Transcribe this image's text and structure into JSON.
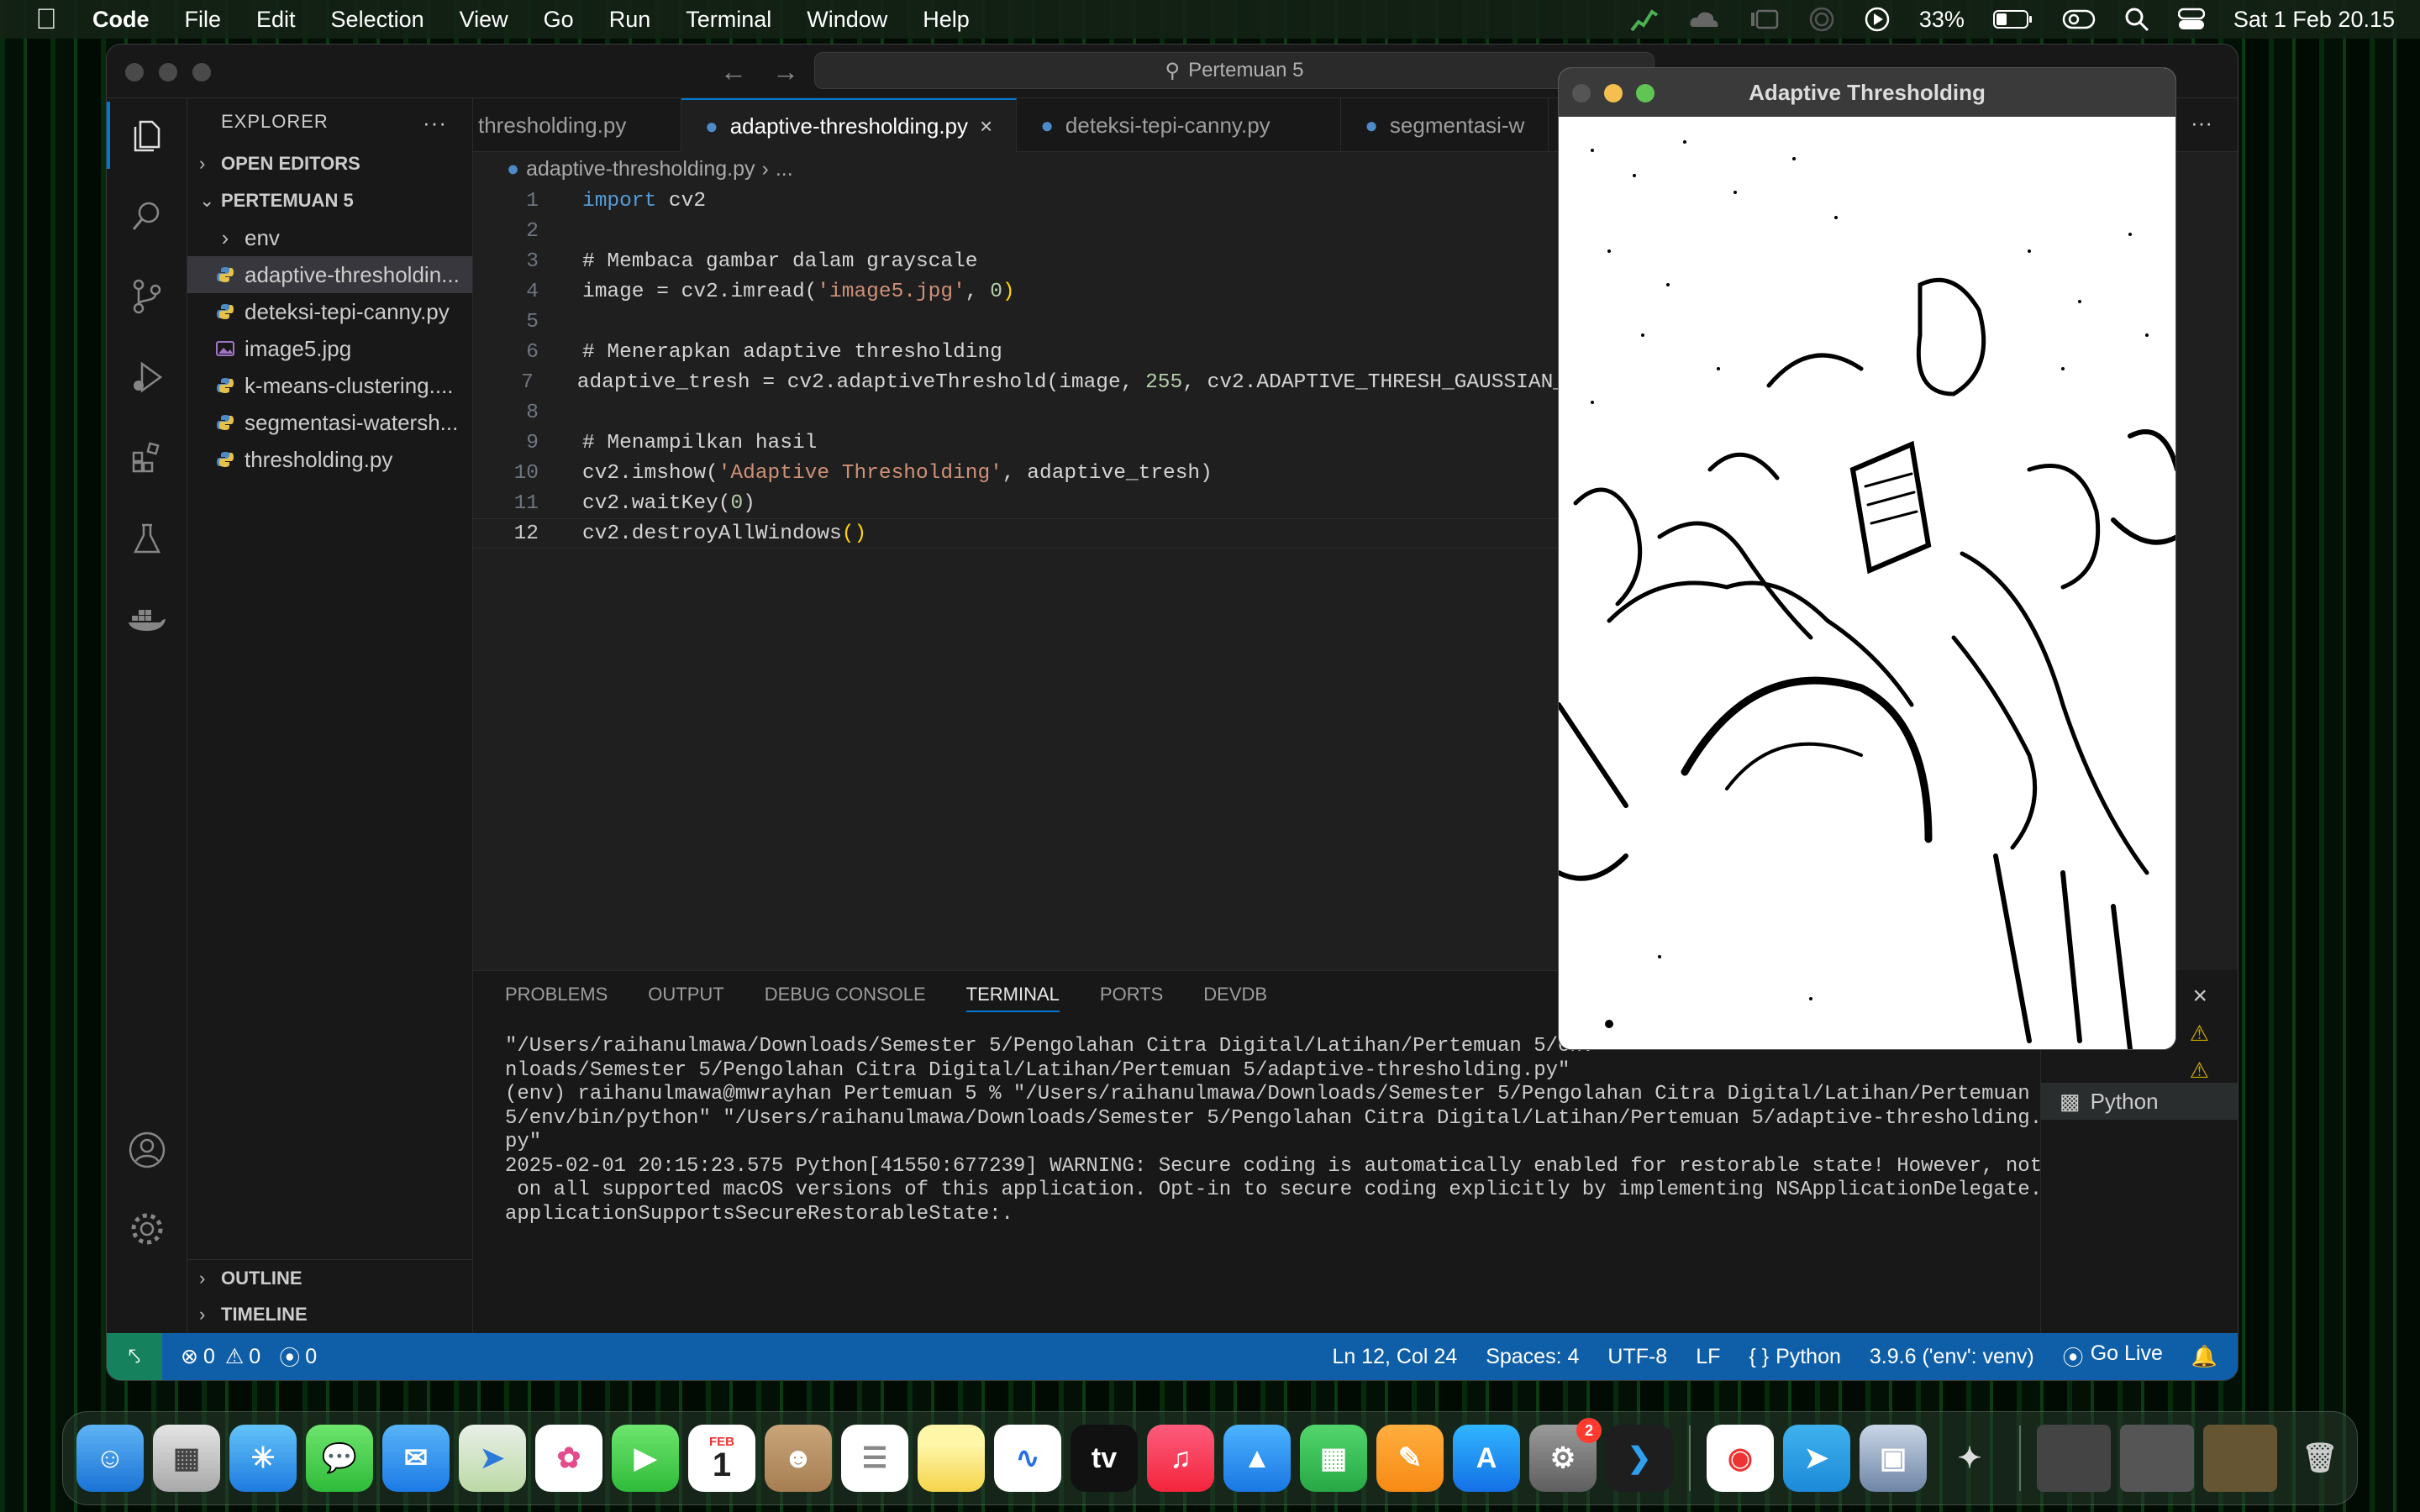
{
  "menubar": {
    "app_name": "Code",
    "items": [
      "File",
      "Edit",
      "Selection",
      "View",
      "Go",
      "Run",
      "Terminal",
      "Window",
      "Help"
    ],
    "battery": "33%",
    "datetime": "Sat 1 Feb  20.15"
  },
  "window": {
    "search_label": "Pertemuan 5"
  },
  "explorer": {
    "title": "EXPLORER",
    "open_editors": "OPEN EDITORS",
    "folder": "PERTEMUAN 5",
    "items": [
      {
        "label": "env",
        "type": "folder"
      },
      {
        "label": "adaptive-thresholdin...",
        "type": "py"
      },
      {
        "label": "deteksi-tepi-canny.py",
        "type": "py"
      },
      {
        "label": "image5.jpg",
        "type": "img"
      },
      {
        "label": "k-means-clustering....",
        "type": "py"
      },
      {
        "label": "segmentasi-watersh...",
        "type": "py"
      },
      {
        "label": "thresholding.py",
        "type": "py"
      }
    ],
    "outline": "OUTLINE",
    "timeline": "TIMELINE"
  },
  "tabs": [
    {
      "label": "thresholding.py"
    },
    {
      "label": "adaptive-thresholding.py"
    },
    {
      "label": "deteksi-tepi-canny.py"
    },
    {
      "label": "segmentasi-w"
    }
  ],
  "breadcrumb": {
    "file": "adaptive-thresholding.py",
    "rest": "..."
  },
  "code_lines": [
    "1",
    "2",
    "3",
    "4",
    "5",
    "6",
    "7",
    "8",
    "9",
    "10",
    "11",
    "12"
  ],
  "code": {
    "l1_kw": "import",
    "l1_rest": " cv2",
    "l3": "# Membaca gambar dalam grayscale",
    "l4_a": "image = cv2.imread(",
    "l4_s": "'image5.jpg'",
    "l4_b": ", ",
    "l4_n": "0",
    "l4_c": ")",
    "l6": "# Menerapkan adaptive thresholding",
    "l7_a": "adaptive_tresh = cv2.adaptiveThreshold(",
    "l7_b": "image, ",
    "l7_n": "255",
    "l7_c": ", cv2.ADAPTIVE_THRESH_GAUSSIAN_",
    "l9": "# Menampilkan hasil",
    "l10_a": "cv2.imshow(",
    "l10_s": "'Adaptive Thresholding'",
    "l10_b": ", adaptive_tresh)",
    "l11_a": "cv2.waitKey(",
    "l11_n": "0",
    "l11_b": ")",
    "l12_a": "cv2.destroyAllWindows",
    "l12_b": "()"
  },
  "panel": {
    "tabs": [
      "PROBLEMS",
      "OUTPUT",
      "DEBUG CONSOLE",
      "TERMINAL",
      "PORTS",
      "DEVDB"
    ],
    "terminal_lines": [
      "\"/Users/raihanulmawa/Downloads/Semester 5/Pengolahan Citra Digital/Latihan/Pertemuan 5/env",
      "nloads/Semester 5/Pengolahan Citra Digital/Latihan/Pertemuan 5/adaptive-thresholding.py\"",
      "(env) raihanulmawa@mwrayhan Pertemuan 5 % \"/Users/raihanulmawa/Downloads/Semester 5/Pengolahan Citra Digital/Latihan/Pertemuan",
      "5/env/bin/python\" \"/Users/raihanulmawa/Downloads/Semester 5/Pengolahan Citra Digital/Latihan/Pertemuan 5/adaptive-thresholding.",
      "py\"",
      "2025-02-01 20:15:23.575 Python[41550:677239] WARNING: Secure coding is automatically enabled for restorable state! However, not",
      " on all supported macOS versions of this application. Opt-in to secure coding explicitly by implementing NSApplicationDelegate.",
      "applicationSupportsSecureRestorableState:."
    ],
    "python_label": "Python"
  },
  "statusbar": {
    "errors": "0",
    "warnings": "0",
    "ports": "0",
    "position": "Ln 12, Col 24",
    "spaces": "Spaces: 4",
    "encoding": "UTF-8",
    "eol": "LF",
    "language": "Python",
    "interpreter": "3.9.6 ('env': venv)",
    "golive": "Go Live"
  },
  "image_window": {
    "title": "Adaptive Thresholding"
  },
  "dock": {
    "calendar_month": "FEB",
    "calendar_day": "1",
    "settings_badge": "2"
  }
}
